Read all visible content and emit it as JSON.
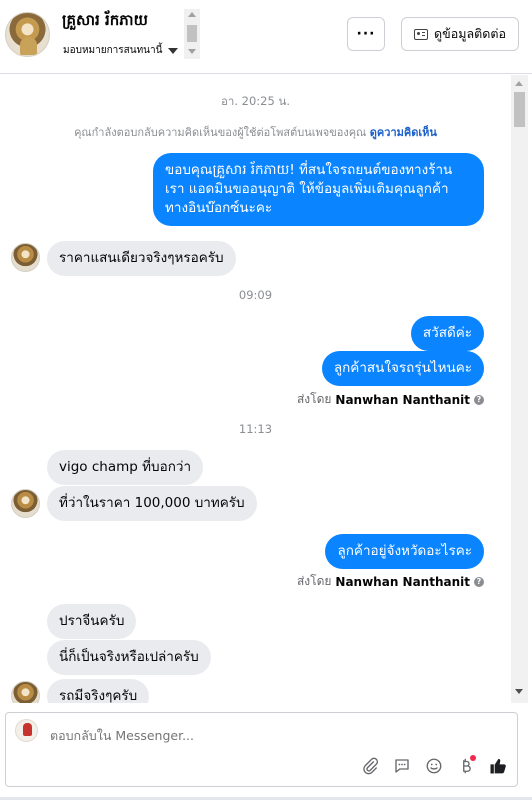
{
  "header": {
    "name": "គ្រួសារ រ័កភាយ",
    "subtitle": "มอบหมายการสนทนานี้",
    "more_label": "···",
    "contact_label": "ดูข้อมูลติดต่อ"
  },
  "messages": {
    "ts1": "อา. 20:25 น.",
    "note_text": "คุณกำลังตอบกลับความคิดเห็นของผู้ใช้ต่อโพสต์บนเพจของคุณ",
    "note_link": "ดูความคิดเห็น",
    "out1_line1": "ขอบคุณគ្រួសារ រ័កភាយ! ที่สนใจรถยนต์ของทางร้าน",
    "out1_line2": "เรา แอดมินขออนุญาติ ให้ข้อมูลเพิ่มเติมคุณลูกค้า",
    "out1_line3": "ทางอินบ๊อกซ์นะคะ",
    "in1": "ราคาแสนเดียวจริงๆหรอครับ",
    "ts2": "09:09",
    "out2": "สวัสดีค่ะ",
    "out3": "ลูกค้าสนใจรถรุ่นไหนคะ",
    "sentby_label": "ส่งโดย",
    "sentby_name": "Nanwhan Nanthanit",
    "ts3": "11:13",
    "in2": "vigo champ ที่บอกว่า",
    "in3": "ที่ว่าในราคา 100,000 บาทครับ",
    "out4": "ลูกค้าอยู่จังหวัดอะไรคะ",
    "in4": "ปราจีนครับ",
    "in5": "นี่ก็เป็นจริงหรือเปล่าครับ",
    "in6": "รถมีจริงๆครับ"
  },
  "composer": {
    "placeholder": "ตอบกลับใน Messenger..."
  },
  "icons": {
    "tools": [
      "paperclip-icon",
      "saved-reply-icon",
      "emoji-icon",
      "baht-icon",
      "like-icon"
    ]
  },
  "colors": {
    "outgoing_bubble": "#0a84ff",
    "incoming_bubble": "#e9ebee",
    "link": "#1a60c9",
    "notification_dot": "#f02849"
  }
}
